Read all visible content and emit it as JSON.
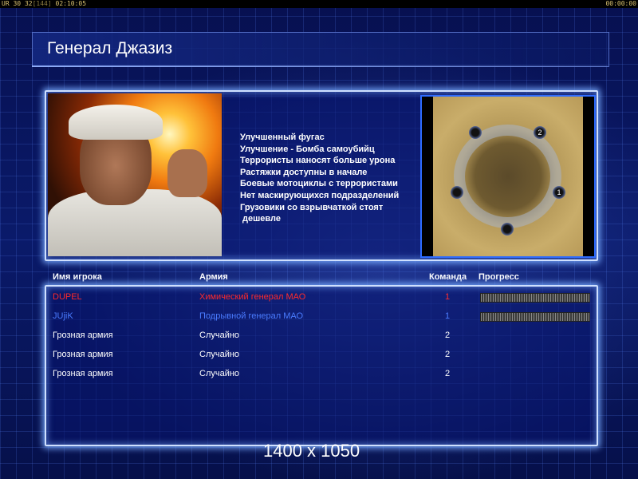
{
  "topbar": {
    "left_prefix": "UR",
    "left_value1": "30",
    "left_value2": "32",
    "left_bracket": "[144]",
    "left_time": "02:10:05",
    "right_time": "00:00:00"
  },
  "page_title": "Генерал Джазиз",
  "bonuses": [
    "Улучшенный фугас",
    "Улучшение - Бомба самоубийц",
    "Террористы наносят больше урона",
    "Растяжки доступны в начале",
    "Боевые мотоциклы с террористами",
    "Нет маскирующихся подразделений",
    "Грузовики со взрывчаткой стоят",
    "дешевле"
  ],
  "minimap": {
    "bases": [
      "2",
      "",
      "",
      "1",
      ""
    ]
  },
  "players_table": {
    "headers": {
      "name": "Имя игрока",
      "army": "Армия",
      "team": "Команда",
      "progress": "Прогресс"
    },
    "rows": [
      {
        "name": "DUPEL",
        "army": "Химический генерал МАО",
        "team": "1",
        "color": "#ff2a2a",
        "progress": 1.0
      },
      {
        "name": "JUjiK",
        "army": "Подрывной генерал МАО",
        "team": "1",
        "color": "#4a7cff",
        "progress": 1.0
      },
      {
        "name": "Грозная армия",
        "army": "Случайно",
        "team": "2",
        "color": "#ffffff"
      },
      {
        "name": "Грозная армия",
        "army": "Случайно",
        "team": "2",
        "color": "#ffffff"
      },
      {
        "name": "Грозная армия",
        "army": "Случайно",
        "team": "2",
        "color": "#ffffff"
      }
    ]
  },
  "resolution_label": "1400 x 1050"
}
